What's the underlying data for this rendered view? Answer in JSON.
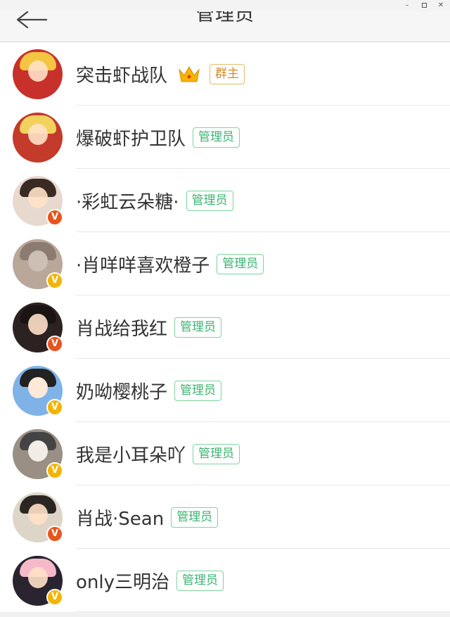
{
  "window": {
    "min_icon": "minimize-icon",
    "max_icon": "maximize-icon",
    "close_icon": "close-icon"
  },
  "header": {
    "title": "管理员",
    "back_icon": "back-arrow-icon"
  },
  "colors": {
    "admin_tag": "#3cb371",
    "owner_tag": "#d18b2b",
    "badge_red": "#e8541f",
    "badge_gold": "#f2b500"
  },
  "members": [
    {
      "name": "突击虾战队",
      "role": "群主",
      "crown": true,
      "badge": null
    },
    {
      "name": "爆破虾护卫队",
      "role": "管理员",
      "badge": null
    },
    {
      "name": "·彩虹云朵糖·",
      "role": "管理员",
      "badge": "red"
    },
    {
      "name": "·肖咩咩喜欢橙子",
      "role": "管理员",
      "badge": "gold"
    },
    {
      "name": "肖战给我红",
      "role": "管理员",
      "badge": "red"
    },
    {
      "name": "奶呦樱桃子",
      "role": "管理员",
      "badge": "gold"
    },
    {
      "name": "我是小耳朵吖",
      "role": "管理员",
      "badge": "gold"
    },
    {
      "name": "肖战·Sean",
      "role": "管理员",
      "badge": "red"
    },
    {
      "name": "only三明治",
      "role": "管理员",
      "badge": "gold"
    }
  ]
}
